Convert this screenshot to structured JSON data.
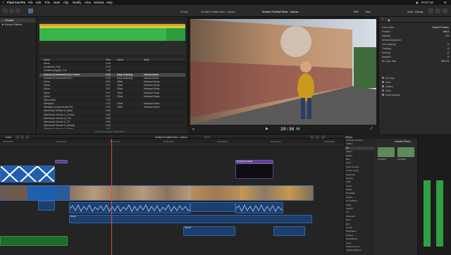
{
  "menubar": {
    "app_name": "Final Cut Pro",
    "menus": [
      "File",
      "Edit",
      "Trim",
      "Mark",
      "Clip",
      "Modify",
      "View",
      "Window",
      "Help"
    ],
    "clock": "Fri 07:18"
  },
  "toolbar": {
    "library_label": "Photos",
    "viewer_title": "Scottish Football Show - Opener",
    "zoom": "94%",
    "view_label": "View",
    "inspector_title": "Scott - Overlay"
  },
  "sidebar": {
    "items": [
      {
        "label": "iTunes",
        "selected": true
      },
      {
        "label": "Sound Effects",
        "selected": false
      }
    ]
  },
  "browser": {
    "columns": [
      "Name",
      "Time",
      "Genre",
      "Artist"
    ],
    "rows": [
      {
        "name": "Alone",
        "time": "0:45",
        "genre": "",
        "artist": ""
      },
      {
        "name": "Avalanche_Full",
        "time": "2:15",
        "genre": "",
        "artist": ""
      },
      {
        "name": "Sektionsaufgabe_Full",
        "time": "1:48",
        "genre": "",
        "artist": ""
      },
      {
        "name": "Autumn (Commercial Ext.) Theme",
        "time": "0:30",
        "genre": "Easy Listening",
        "artist": "Various Artists"
      },
      {
        "name": "Ambient (Commercial Ext.)",
        "time": "0:30",
        "genre": "Easy Listening",
        "artist": "Various Artists"
      },
      {
        "name": "Africa",
        "time": "0:57",
        "genre": "Other",
        "artist": "Notepad Music"
      },
      {
        "name": "Africa",
        "time": "0:57",
        "genre": "Other",
        "artist": "Notepad Music"
      },
      {
        "name": "Africa",
        "time": "0:57",
        "genre": "Other",
        "artist": "Notepad Music"
      },
      {
        "name": "Africa",
        "time": "0:57",
        "genre": "Other",
        "artist": "Notepad Music"
      },
      {
        "name": "Africa",
        "time": "0:57",
        "genre": "Other",
        "artist": "Notepad Music"
      },
      {
        "name": "Africa Indie",
        "time": "1:16",
        "genre": "",
        "artist": ""
      },
      {
        "name": "Afterglow",
        "time": "2:02",
        "genre": "Other",
        "artist": "Notepad Music"
      },
      {
        "name": "Afterglow (Commercial Ext)",
        "time": "0:30",
        "genre": "Other",
        "artist": "Notepad Music"
      },
      {
        "name": "Aftershock Version A_Bass",
        "time": "0:59",
        "genre": "",
        "artist": ""
      },
      {
        "name": "Aftershock Version A_Drums",
        "time": "0:54",
        "genre": "",
        "artist": ""
      },
      {
        "name": "Aftershock Version A_Full",
        "time": "0:54",
        "genre": "",
        "artist": ""
      },
      {
        "name": "Aftershock Version A_FX",
        "time": "0:54",
        "genre": "",
        "artist": ""
      },
      {
        "name": "Aftershock Version A_Melody",
        "time": "0:54",
        "genre": "",
        "artist": ""
      },
      {
        "name": "Aftershock Version A_Piano",
        "time": "0:54",
        "genre": "",
        "artist": ""
      },
      {
        "name": "Aftershock Version A_Strings",
        "time": "0:54",
        "genre": "",
        "artist": ""
      }
    ],
    "status": "1 of 6,211 selected, 00:00:30:00"
  },
  "viewer": {
    "timecode": "20:36",
    "controls": [
      "play",
      "fullscreen"
    ]
  },
  "inspector": {
    "sections": [
      {
        "label": "Video Sync",
        "value": "Default Position"
      },
      {
        "label": "Position",
        "value": "158.8"
      },
      {
        "label": "Opacity",
        "value": "0.0"
      },
      {
        "label": "Vertical Alignment",
        "value": ""
      },
      {
        "label": "Line Spacing",
        "value": "0"
      },
      {
        "label": "Tracking",
        "value": "0"
      },
      {
        "label": "Kerning",
        "value": "0"
      },
      {
        "label": "Baseline",
        "value": "0"
      },
      {
        "label": "All Caps Size",
        "value": "80.0 %"
      }
    ],
    "checks": [
      {
        "label": "All Caps",
        "checked": false
      },
      {
        "label": "Face",
        "checked": true
      },
      {
        "label": "Outline",
        "checked": true
      },
      {
        "label": "Glow",
        "checked": false
      },
      {
        "label": "Drop Shadow",
        "checked": true
      }
    ]
  },
  "timeline": {
    "index_label": "Index",
    "project_title": "Scottish Football Show - Opener",
    "duration": "30:17",
    "ruler": [
      "00:00:00:00",
      "00:00:05:00",
      "00:00:10:00",
      "00:00:15:00",
      "00:00:20:00",
      "00:00:25:00",
      "00:00:30:00"
    ],
    "clips": [
      {
        "label": "",
        "kind": "vid"
      },
      {
        "label": "Lower Third",
        "kind": "purple"
      },
      {
        "label": "Scottish Football",
        "kind": "purple"
      },
      {
        "label": "",
        "kind": "aud"
      },
      {
        "label": "Music",
        "kind": "aud"
      },
      {
        "label": "Sound",
        "kind": "aud"
      }
    ]
  },
  "effects": {
    "title": "Effects",
    "categories": [
      "All Video & Audio",
      "VIDEO",
      "All",
      "Adjust",
      "Basics",
      "Blur",
      "Color",
      "Color Presets",
      "Comic Looks",
      "Distortion",
      "Keying",
      "Light",
      "Looks",
      "Masks",
      "Nostalgia",
      "Stylize",
      "Text Effects",
      "Tiling",
      "AUDIO",
      "All",
      "Distortion",
      "Echo",
      "EQ",
      "Levels",
      "Modulation",
      "Spaces",
      "Specialized",
      "Voice",
      "FxFactory Pro",
      "Installed Effects"
    ],
    "grid_title": "Installed Effects",
    "thumbs": [
      "UNIVIEW",
      "UNIVIEW"
    ]
  }
}
